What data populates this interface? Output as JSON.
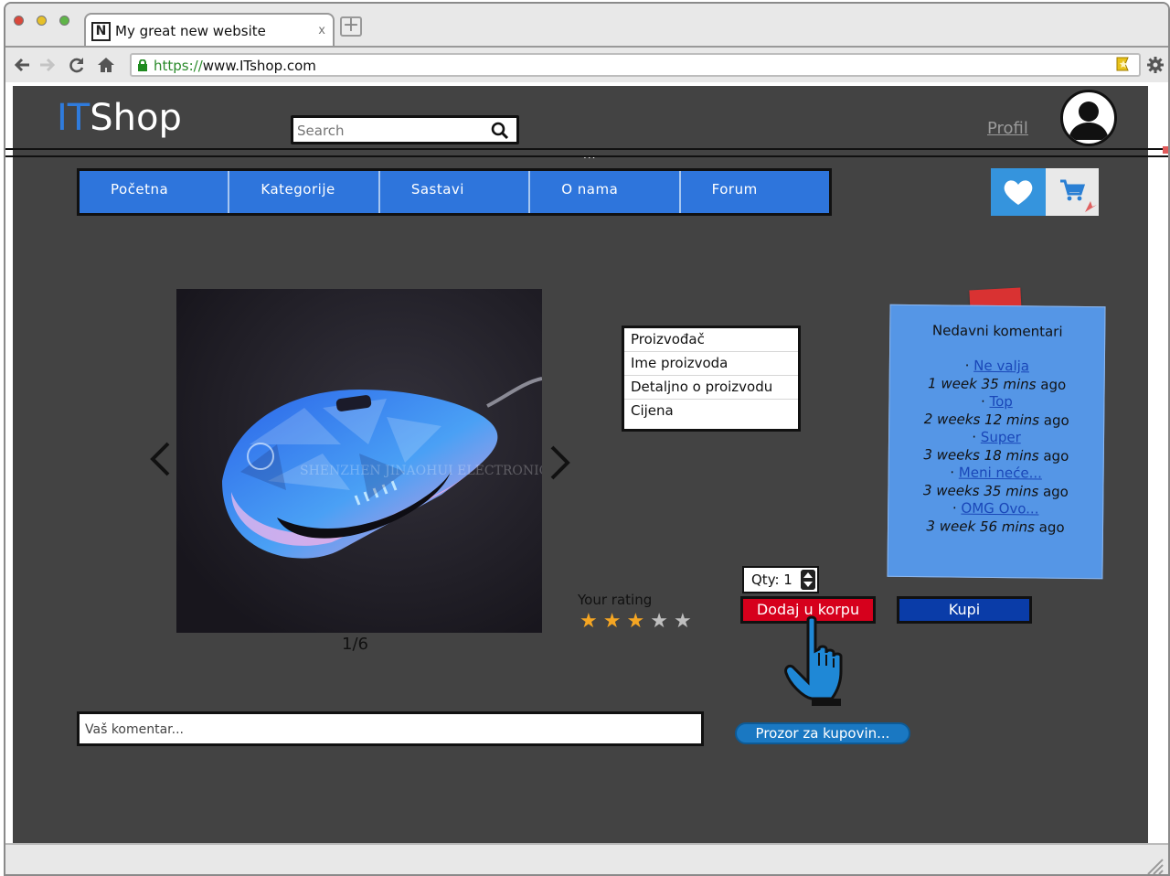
{
  "browser": {
    "tab_icon": "N",
    "tab_title": "My great new website",
    "tab_close": "x",
    "new_tab": "+",
    "url_scheme": "https://",
    "url_rest": "www.ITshop.com",
    "icons": [
      "back-arrow-icon",
      "forward-arrow-icon",
      "reload-icon",
      "home-icon",
      "lock-icon",
      "bookmark-icon",
      "settings-icon"
    ]
  },
  "header": {
    "logo_it": "IT",
    "logo_shop": "Shop",
    "search_placeholder": "Search",
    "profile_link": "Profil",
    "dots": "..."
  },
  "nav": {
    "items": [
      "Početna",
      "Kategorije",
      "Sastavi",
      "O nama",
      "Forum"
    ]
  },
  "product": {
    "image_counter": "1/6",
    "watermark": "SHENZHEN JINAOHUI ELECTRONICS CO",
    "info": [
      "Proizvođač",
      "Ime proizvoda",
      "Detaljno o proizvodu",
      "Cijena"
    ],
    "rating_label": "Your rating",
    "rating": 3,
    "rating_max": 5,
    "qty_label": "Qty: 1",
    "add_to_cart": "Dodaj u korpu",
    "buy": "Kupi",
    "purchase_window": "Prozor za kupovin..."
  },
  "comment": {
    "placeholder": "Vaš komentar..."
  },
  "recent_comments": {
    "title": "Nedavni komentari",
    "items": [
      {
        "link": "Ne valja",
        "time": "1 week 35 mins",
        "ago": "ago"
      },
      {
        "link": "Top",
        "time": "2 weeks 12 mins",
        "ago": "ago"
      },
      {
        "link": "Super",
        "time": "3 weeks 18 mins",
        "ago": "ago"
      },
      {
        "link": "Meni neće...",
        "time": "3 weeks 35 mins",
        "ago": "ago"
      },
      {
        "link": "OMG Ovo...",
        "time": "3 week 56 mins",
        "ago": "ago"
      }
    ]
  },
  "colors": {
    "page_bg": "#434343",
    "nav_blue": "#2e75dc",
    "add_red": "#d6001c",
    "buy_blue": "#0a3ca8",
    "note_blue": "#5596e6",
    "star_on": "#f5a623",
    "star_off": "#bfbfbf"
  }
}
